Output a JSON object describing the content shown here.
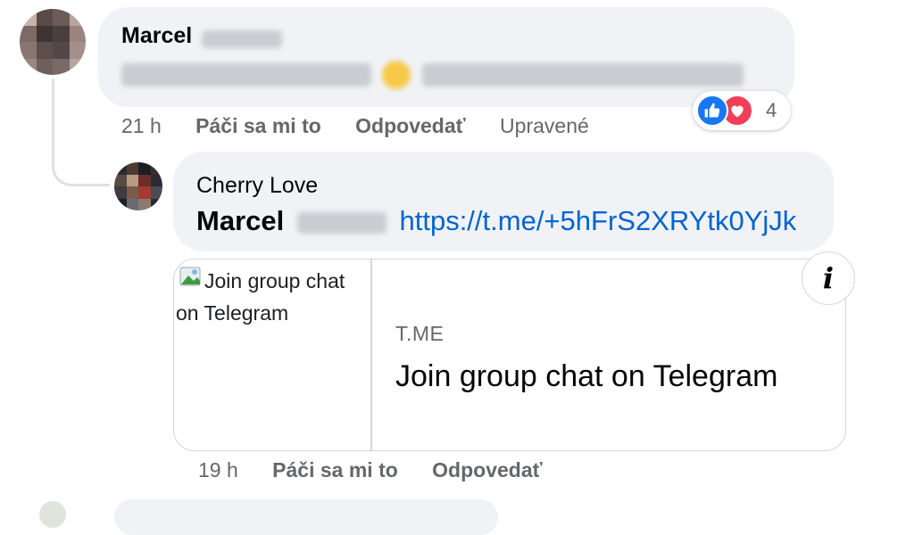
{
  "comments": [
    {
      "author": "Marcel",
      "text_blurred": true,
      "time": "21 h",
      "like_label": "Páči sa mi to",
      "reply_label": "Odpovedať",
      "edited_label": "Upravené",
      "reactions": {
        "icons": [
          "like-icon",
          "love-icon"
        ],
        "count": "4"
      }
    }
  ],
  "reply": {
    "author": "Cherry Love",
    "mention": "Marcel",
    "link": "https://t.me/+5hFrS2XRYtk0YjJk",
    "preview": {
      "image_alt": "Join group chat on Telegram",
      "domain": "T.ME",
      "title": "Join group chat on Telegram"
    },
    "time": "19 h",
    "like_label": "Páči sa mi to",
    "reply_label": "Odpovedať"
  },
  "colors": {
    "bubble": "#f0f2f5",
    "link": "#0064d1",
    "meta": "#65676b",
    "like": "#1877f2",
    "love": "#f33e58"
  }
}
